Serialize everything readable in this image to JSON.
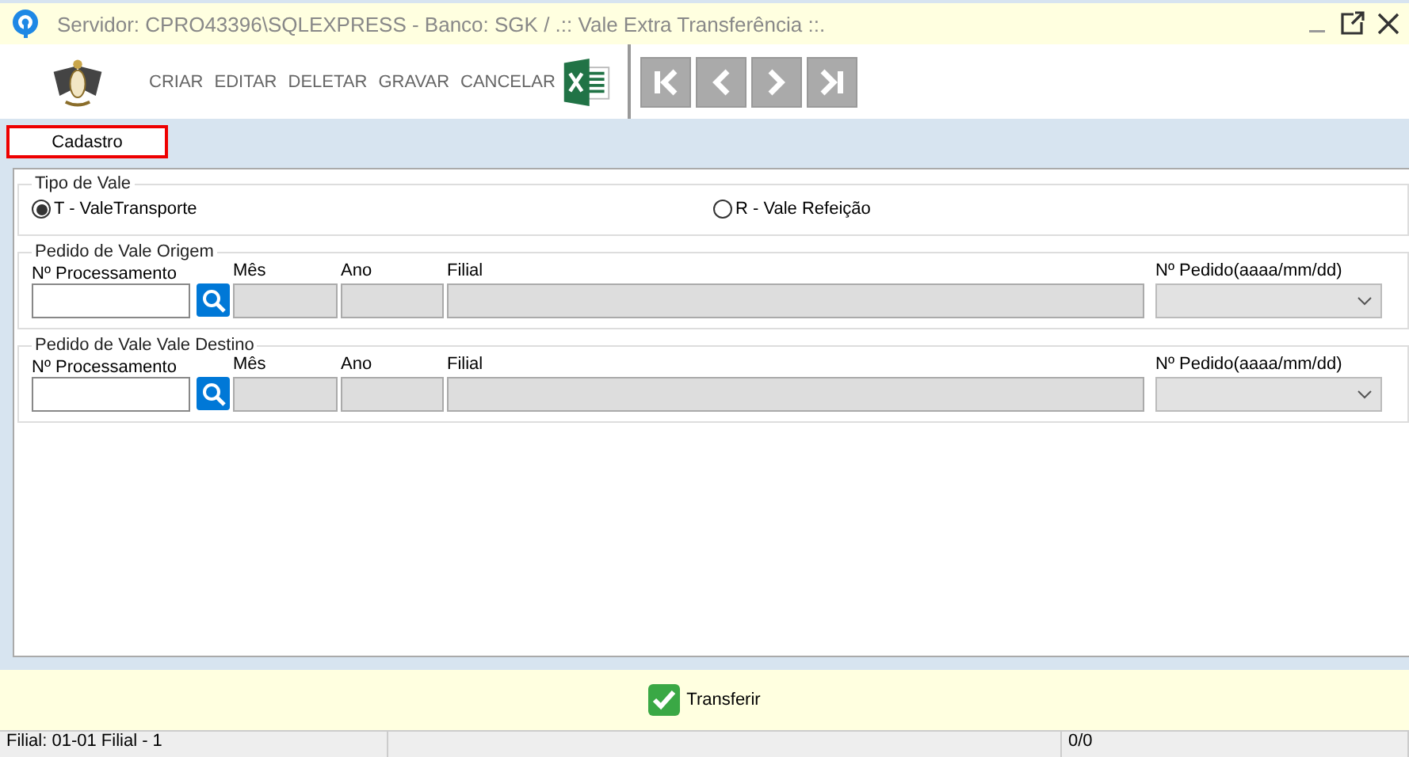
{
  "window": {
    "title": "Servidor: CPRO43396\\SQLEXPRESS - Banco: SGK / .:: Vale Extra Transferência ::."
  },
  "toolbar": {
    "actions": [
      "CRIAR",
      "EDITAR",
      "DELETAR",
      "GRAVAR",
      "CANCELAR"
    ]
  },
  "tabs": [
    {
      "label": "Cadastro",
      "selected": true
    }
  ],
  "tipo_de_vale": {
    "legend": "Tipo de Vale",
    "options": [
      {
        "label": "T -  ValeTransporte",
        "selected": true
      },
      {
        "label": "R - Vale Refeição",
        "selected": false
      }
    ]
  },
  "sections": [
    {
      "legend": "Pedido de Vale Origem",
      "fields": [
        {
          "label": "Nº Processamento",
          "kind": "lookup",
          "disabled": false
        },
        {
          "label": "Mês",
          "kind": "text",
          "disabled": true
        },
        {
          "label": "Ano",
          "kind": "text",
          "disabled": true
        },
        {
          "label": "Filial",
          "kind": "wide",
          "disabled": true
        },
        {
          "label": "Nº Pedido(aaaa/mm/dd)",
          "kind": "select",
          "disabled": true
        }
      ]
    },
    {
      "legend": "Pedido de Vale Vale Destino",
      "fields": [
        {
          "label": "Nº Processamento",
          "kind": "lookup",
          "disabled": false
        },
        {
          "label": "Mês",
          "kind": "text",
          "disabled": true
        },
        {
          "label": "Ano",
          "kind": "text",
          "disabled": true
        },
        {
          "label": "Filial",
          "kind": "wide",
          "disabled": true
        },
        {
          "label": "Nº Pedido(aaaa/mm/dd)",
          "kind": "select",
          "disabled": true
        }
      ]
    }
  ],
  "footer": {
    "button": "Transferir"
  },
  "status_bar": {
    "left": "Filial: 01-01 Filial - 1",
    "right": "0/0"
  }
}
